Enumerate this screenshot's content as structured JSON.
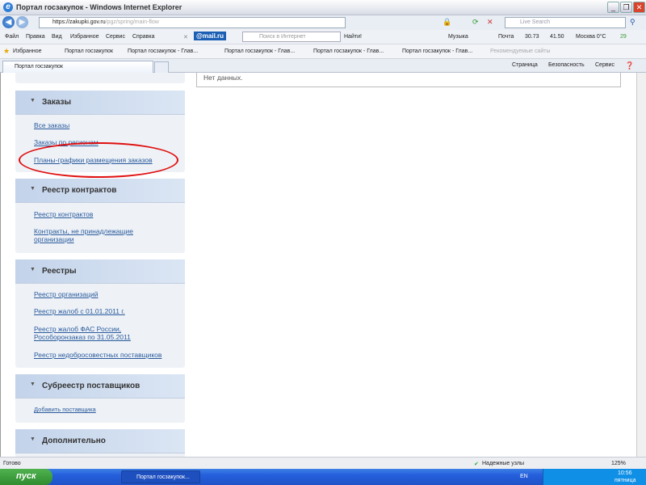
{
  "window": {
    "title": "Портал госзакупок - Windows Internet Explorer"
  },
  "address": {
    "url_host": "https://zakupki.gov.ru",
    "url_path": "/pgz/spring/main-flow",
    "search_placeholder": "Live Search"
  },
  "menu": {
    "items": [
      "Файл",
      "Правка",
      "Вид",
      "Избранное",
      "Сервис",
      "Справка"
    ],
    "mailru": "@mail.ru",
    "search_placeholder": "Поиск в Интернет",
    "find": "Найти!",
    "music": "Музыка",
    "mail": "Почта",
    "usd": "30.73",
    "eur": "41.50",
    "weather": "Москва 0°C",
    "count": "29"
  },
  "favorites": {
    "label": "Избранное",
    "items": [
      "Портал госзакупок",
      "Портал госзакупок - Глав...",
      "Портал госзакупок - Глав...",
      "Портал госзакупок - Глав...",
      "Портал госзакупок - Глав..."
    ],
    "suggested": "Рекомендуемые сайты"
  },
  "tabs": {
    "active": "Портал госзакупок",
    "tools": [
      "Страница",
      "Безопасность",
      "Сервис"
    ]
  },
  "main": {
    "no_data": "Нет данных."
  },
  "sidebar": {
    "panels": [
      {
        "title": "Заказы",
        "links": [
          "Все заказы",
          "Заказы по регионам",
          "Планы-графики размещения заказов"
        ]
      },
      {
        "title": "Реестр контрактов",
        "links": [
          "Реестр контрактов",
          "Контракты, не принадлежащие организации"
        ]
      },
      {
        "title": "Реестры",
        "links": [
          "Реестр организаций",
          "Реестр жалоб с 01.01.2011 г.",
          "Реестр жалоб ФАС России, Рособоронзаказ по 31.05.2011",
          "Реестр недобросовестных поставщиков"
        ]
      },
      {
        "title": "Субреестр поставщиков",
        "links": [
          "Добавить поставщика"
        ]
      },
      {
        "title": "Дополнительно",
        "links": []
      }
    ]
  },
  "status": {
    "text": "Готово",
    "zone": "Надежные узлы",
    "zoom": "125%"
  },
  "taskbar": {
    "start": "пуск",
    "task": "Портал госзакупок...",
    "lang": "EN",
    "time": "10:56",
    "day": "пятница"
  },
  "colors": {
    "highlight": "#e01010",
    "link": "#2a5a9c"
  }
}
